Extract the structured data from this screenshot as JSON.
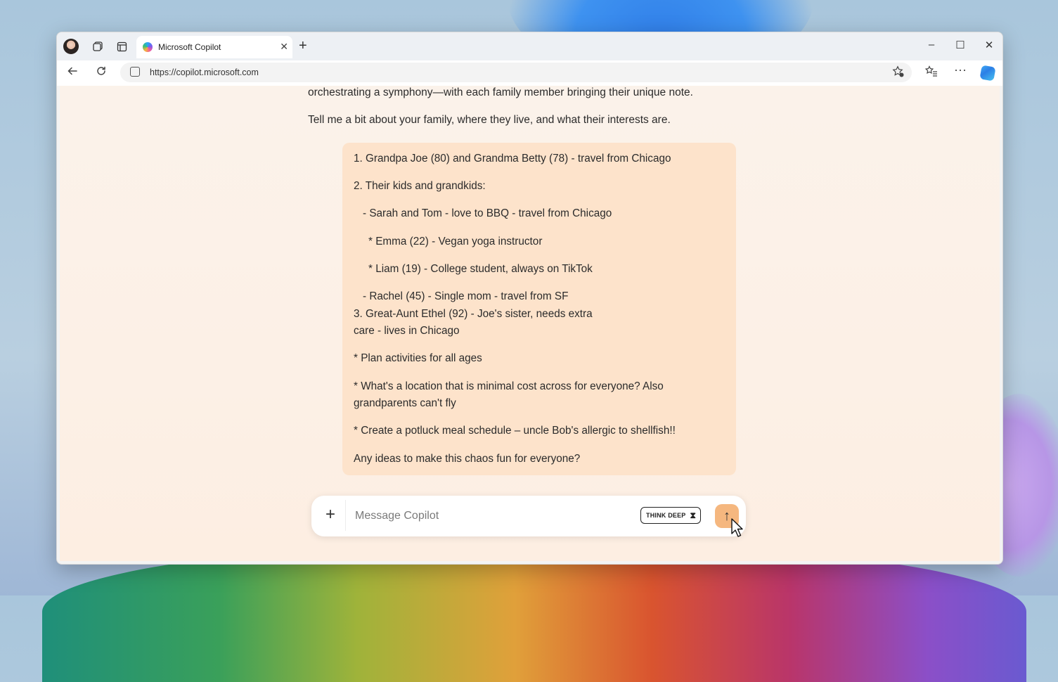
{
  "browser": {
    "tab": {
      "title": "Microsoft Copilot",
      "close_glyph": "✕"
    },
    "new_tab_glyph": "+",
    "window_controls": {
      "minimize": "–",
      "maximize": "☐",
      "close": "✕"
    },
    "address": {
      "url": "https://copilot.microsoft.com"
    },
    "icons": [
      "profile-avatar",
      "workspaces-icon",
      "tab-actions-icon",
      "back-icon",
      "refresh-icon",
      "site-info-icon",
      "favorite-add-icon",
      "favorites-icon",
      "more-icon",
      "copilot-icon"
    ]
  },
  "conversation": {
    "assistant_lines": [
      "orchestrating a symphony—with each family member bringing their unique note.",
      "Tell me a bit about your family, where they live, and what their interests are."
    ],
    "user_message": [
      "1. Grandpa Joe (80) and Grandma Betty (78) - travel from Chicago",
      "2. Their kids and grandkids:",
      "  - Sarah and Tom - love to BBQ - travel from Chicago",
      "    * Emma (22) - Vegan yoga instructor",
      "    * Liam (19) - College student, always on TikTok",
      "  - Rachel (45) - Single mom - travel from SF",
      "3. Great-Aunt Ethel (92) - Joe's sister, needs extra",
      "care - lives in Chicago",
      "* Plan activities for all ages",
      "* What's a location that is minimal cost across for everyone? Also",
      "grandparents can't fly",
      "* Create a potluck meal schedule – uncle Bob's allergic to shellfish!!",
      "Any ideas to make this chaos fun for everyone?"
    ]
  },
  "composer": {
    "placeholder": "Message Copilot",
    "value": "",
    "think_deep_label": "THINK DEEP",
    "plus_glyph": "+",
    "send_glyph": "↑"
  },
  "colors": {
    "bubble": "#fde3cb",
    "send_button": "#f5b77f",
    "content_bg": "#fbf2ea"
  }
}
